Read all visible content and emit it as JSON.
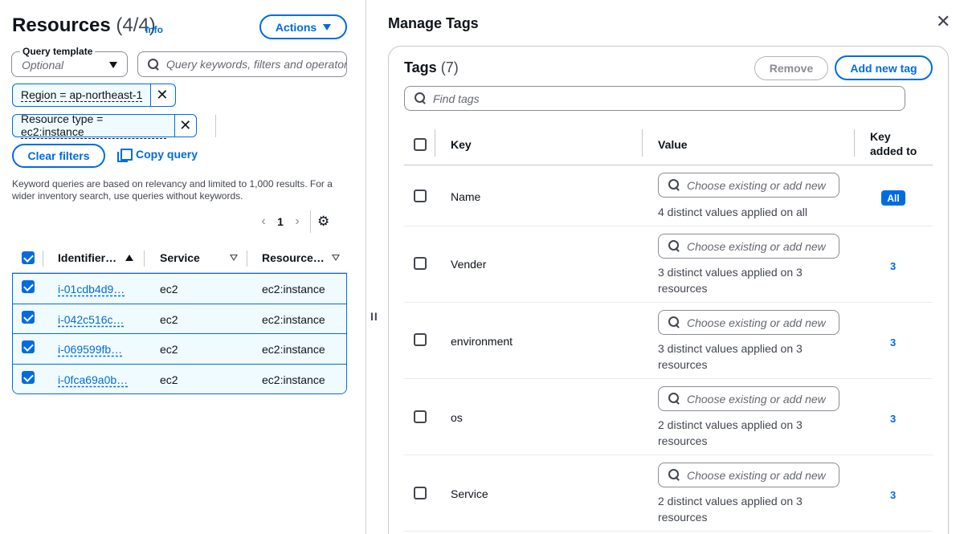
{
  "resources": {
    "title": "Resources",
    "count": "(4/4)",
    "info_label": "Info",
    "actions_label": "Actions",
    "query_template": {
      "label": "Query template",
      "value": "Optional"
    },
    "query_search_placeholder": "Query keywords, filters and operators",
    "filter_tokens": [
      {
        "label": "Region = ap-northeast-1"
      },
      {
        "label": "Resource type = ec2:instance"
      }
    ],
    "clear_filters_label": "Clear filters",
    "copy_query_label": "Copy query",
    "keyword_note": "Keyword queries are based on relevancy and limited to 1,000 results. For a wider inventory search, use queries without keywords.",
    "pagination": {
      "prev": "‹",
      "page": "1",
      "next": "›"
    },
    "table": {
      "columns": [
        "Identifier…",
        "Service",
        "Resource…"
      ],
      "rows": [
        {
          "identifier": "i-01cdb4d9…",
          "service": "ec2",
          "resource_type": "ec2:instance"
        },
        {
          "identifier": "i-042c516c…",
          "service": "ec2",
          "resource_type": "ec2:instance"
        },
        {
          "identifier": "i-069599fb…",
          "service": "ec2",
          "resource_type": "ec2:instance"
        },
        {
          "identifier": "i-0fca69a0b…",
          "service": "ec2",
          "resource_type": "ec2:instance"
        }
      ]
    }
  },
  "split_handle": "II",
  "manage_tags": {
    "title": "Manage Tags",
    "close": "✕",
    "tags_title": "Tags",
    "tags_count": "(7)",
    "remove_label": "Remove",
    "add_label": "Add new tag",
    "find_placeholder": "Find tags",
    "columns": {
      "key": "Key",
      "value": "Value",
      "added_to_line1": "Key",
      "added_to_line2": "added to"
    },
    "value_placeholder": "Choose existing or add new",
    "rows": [
      {
        "key": "Name",
        "note": "4 distinct values applied on all",
        "added_to": "All"
      },
      {
        "key": "Vender",
        "note": "3 distinct values applied on 3 resources",
        "added_to": "3"
      },
      {
        "key": "environment",
        "note": "3 distinct values applied on 3 resources",
        "added_to": "3"
      },
      {
        "key": "os",
        "note": "2 distinct values applied on 3 resources",
        "added_to": "3"
      },
      {
        "key": "Service",
        "note": "2 distinct values applied on 3 resources",
        "added_to": "3"
      }
    ]
  },
  "colors": {
    "accent": "#006ce0",
    "selected_row": "#f0fbff",
    "border": "#c6c6cd"
  }
}
